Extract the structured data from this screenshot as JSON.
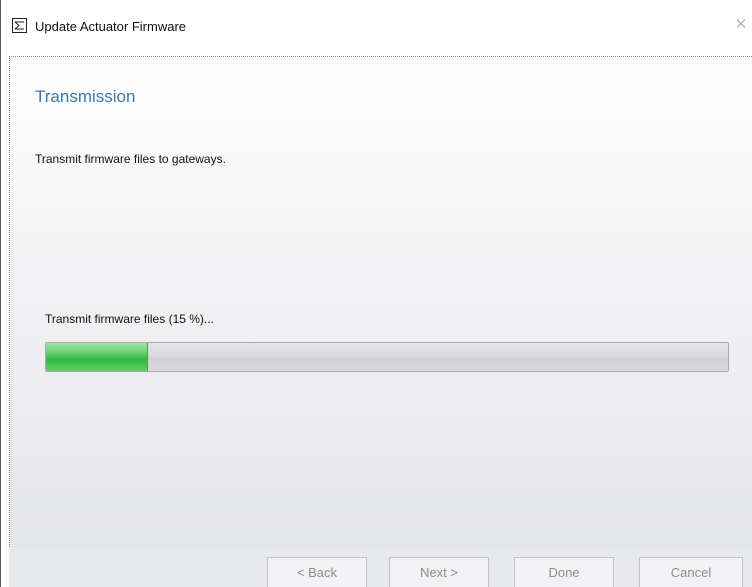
{
  "window": {
    "title": "Update Actuator Firmware",
    "icon": "wizard-list-icon",
    "close_symbol": "✕"
  },
  "page": {
    "heading": "Transmission",
    "description": "Transmit firmware files to gateways."
  },
  "progress": {
    "label": "Transmit firmware files (15 %)...",
    "percent": 15,
    "fill_color": "#34b83f"
  },
  "buttons": {
    "back": "< Back",
    "next": "Next >",
    "done": "Done",
    "cancel": "Cancel"
  },
  "colors": {
    "heading": "#3c78a8",
    "disabled_text": "#8d8d8d"
  }
}
